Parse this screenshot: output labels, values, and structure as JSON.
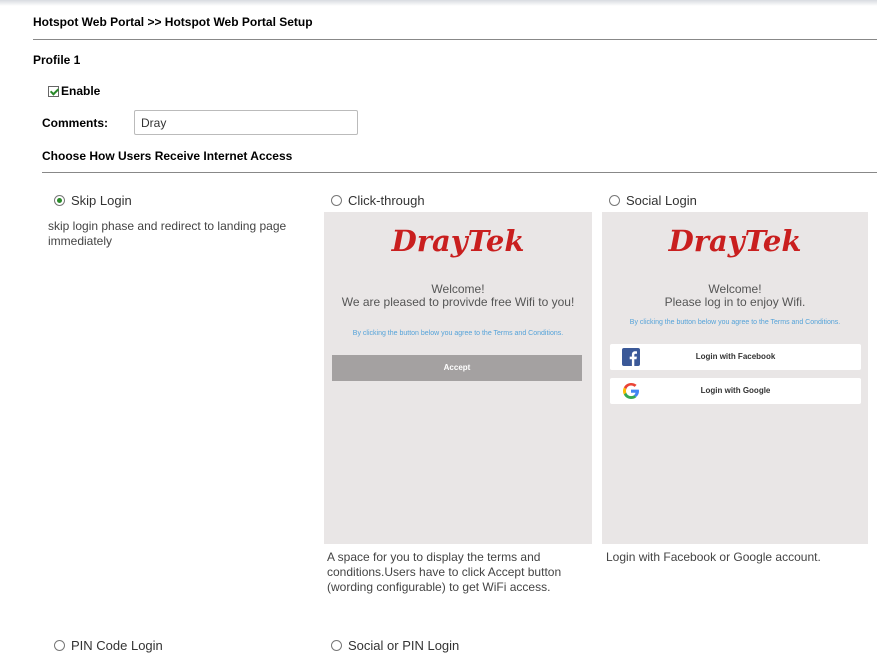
{
  "breadcrumb": "Hotspot Web Portal >> Hotspot Web Portal Setup",
  "profile_title": "Profile 1",
  "enable": {
    "label": "Enable",
    "checked": true
  },
  "comments": {
    "label": "Comments:",
    "value": "Dray"
  },
  "choose_title": "Choose How Users Receive Internet Access",
  "options": {
    "skip": {
      "label": "Skip Login",
      "selected": true,
      "desc": "skip login phase and redirect to landing page immediately"
    },
    "click": {
      "label": "Click-through",
      "desc": "A space for you to display the terms and conditions.Users have to click Accept button (wording configurable) to get WiFi access.",
      "preview": {
        "logo": "DrayTek",
        "welcome": "Welcome!",
        "message": "We are pleased to provivde free Wifi to you!",
        "terms": "By clicking the button below you agree to the Terms and Conditions.",
        "button": "Accept"
      }
    },
    "social": {
      "label": "Social Login",
      "desc": "Login with Facebook or Google account.",
      "preview": {
        "logo": "DrayTek",
        "welcome": "Welcome!",
        "message": "Please log in to enjoy Wifi.",
        "terms": "By clicking the button below you agree to the Terms and Conditions.",
        "facebook": "Login with Facebook",
        "google": "Login with Google"
      }
    },
    "pin": {
      "label": "PIN Code Login"
    },
    "social_pin": {
      "label": "Social or PIN Login"
    }
  },
  "colors": {
    "brand_red": "#c91f1f",
    "radio_green": "#2a8a2a",
    "terms_blue": "#55a3d9"
  }
}
